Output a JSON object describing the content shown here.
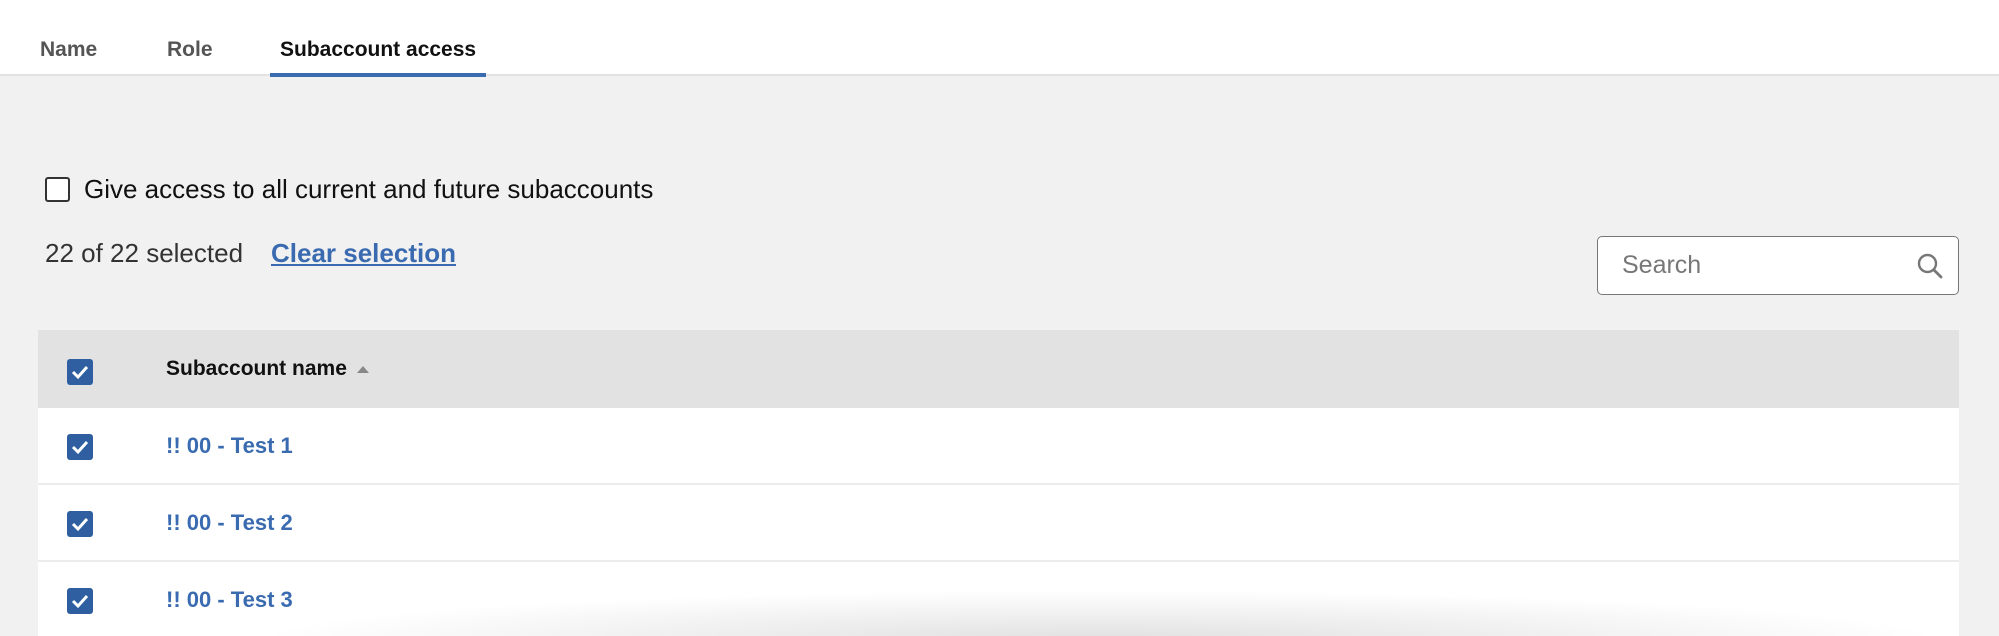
{
  "tabs": [
    {
      "label": "Name",
      "active": false
    },
    {
      "label": "Role",
      "active": false
    },
    {
      "label": "Subaccount access",
      "active": true
    }
  ],
  "all_access": {
    "label": "Give access to all current and future subaccounts",
    "checked": false
  },
  "selection": {
    "count_text": "22 of 22 selected",
    "clear_label": "Clear selection"
  },
  "search": {
    "placeholder": "Search",
    "value": "",
    "icon": "search-icon"
  },
  "table": {
    "header_name": "Subaccount name",
    "sort": "ascending",
    "header_checked": true,
    "rows": [
      {
        "name": "!! 00 - Test 1",
        "checked": true
      },
      {
        "name": "!! 00 - Test 2",
        "checked": true
      },
      {
        "name": "!! 00 - Test 3",
        "checked": true
      }
    ]
  },
  "colors": {
    "accent": "#3a6bb0",
    "checkbox": "#2f5fa0",
    "background": "#f1f1f1",
    "header_bg": "#e2e2e2"
  }
}
